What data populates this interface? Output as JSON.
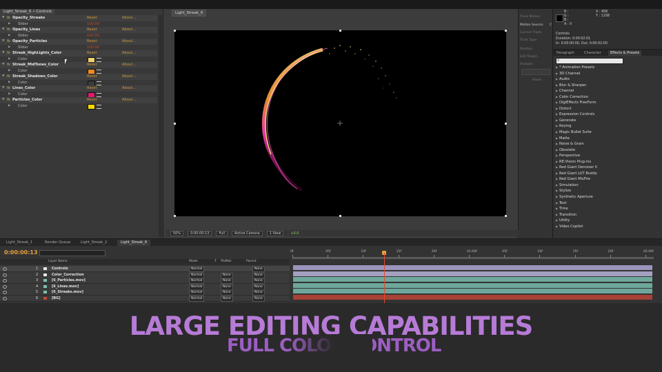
{
  "effect_controls": {
    "tab": "Light_Streak_6 • Controls",
    "reset_label": "Reset",
    "about_label": "About...",
    "rows": [
      {
        "kind": "effect",
        "name": "Opacity_Streaks"
      },
      {
        "kind": "sub",
        "name": "Slider",
        "value": "100.00"
      },
      {
        "kind": "effect",
        "name": "Opacity_Lines"
      },
      {
        "kind": "sub",
        "name": "Slider",
        "value": "100.00"
      },
      {
        "kind": "effect",
        "name": "Opacity_Particles"
      },
      {
        "kind": "sub",
        "name": "Slider",
        "value": "100.00"
      },
      {
        "kind": "effect",
        "name": "Streak_HighLights_Color"
      },
      {
        "kind": "color",
        "name": "Color",
        "color": "#f1d06e"
      },
      {
        "kind": "effect",
        "name": "Streak_MidTones_Color"
      },
      {
        "kind": "color",
        "name": "Color",
        "color": "#f08a1c"
      },
      {
        "kind": "effect",
        "name": "Streak_Shadows_Color"
      },
      {
        "kind": "color",
        "name": "Color",
        "color": "#3a3a3a"
      },
      {
        "kind": "effect",
        "name": "Lines_Color"
      },
      {
        "kind": "color",
        "name": "Color",
        "color": "#e0196e"
      },
      {
        "kind": "effect",
        "name": "Particles_Color"
      },
      {
        "kind": "color",
        "name": "Color",
        "color": "#f5d800"
      }
    ]
  },
  "viewer": {
    "tab": "Light_Streak_6",
    "toolbar": [
      "50%",
      "0:00:00:13",
      "Full",
      "Active Camera",
      "1 View",
      "+0.0"
    ]
  },
  "tracker_panel": {
    "items": [
      "Track Motion",
      "Motion Source:",
      "Current Track:",
      "Track Type:",
      "Position",
      "Edit Target...",
      "Analyze:",
      "Reset"
    ],
    "motion_source_value": "C"
  },
  "info": {
    "rgba": [
      "R :",
      "G :",
      "B :",
      "A : 0"
    ],
    "xy": [
      "X : 458",
      "Y : 1108"
    ],
    "layer": "Controls",
    "duration": "Duration: 0:00:02:01",
    "in_out": "In: 0:00:00:00, Out: 0:00:02:00"
  },
  "effects_presets": {
    "tabs": [
      "Paragraph",
      "Character",
      "Effects & Presets"
    ],
    "items": [
      "* Animation Presets",
      "3D Channel",
      "Audio",
      "Blur & Sharpen",
      "Channel",
      "Color Correction",
      "DigiEffects FreeForm",
      "Distort",
      "Expression Controls",
      "Generate",
      "Keying",
      "Magic Bullet Suite",
      "Matte",
      "Noise & Grain",
      "Obsolete",
      "Perspective",
      "RE:Vision Plug-ins",
      "Red Giant Denoiser II",
      "Red Giant LUT Buddy",
      "Red Giant MisFire",
      "Simulation",
      "Stylize",
      "Synthetic Aperture",
      "Text",
      "Time",
      "Transition",
      "Utility",
      "Video Copilot"
    ]
  },
  "timeline": {
    "tabs": [
      "Light_Streak_1",
      "Render Queue",
      "Light_Streak_2",
      "Light_Streak_6"
    ],
    "timecode": "0:00:00:13",
    "headers": [
      "Layer Name",
      "Mode",
      "T",
      "TrkMat",
      "Parent"
    ],
    "ruler": [
      "0f",
      "05f",
      "10f",
      "15f",
      "20f",
      "01:00f",
      "05f",
      "10f",
      "15f",
      "20f",
      "02:00f"
    ],
    "layers": [
      {
        "num": "1",
        "name": "Controls",
        "label": "#e8e8e8",
        "bar": "#9b95bd",
        "mode": "Normal",
        "trkmat": "",
        "parent": "None"
      },
      {
        "num": "2",
        "name": "Color_Correction",
        "label": "#e8e8e8",
        "bar": "#a4a0bf",
        "mode": "Normal",
        "trkmat": "None",
        "parent": "None"
      },
      {
        "num": "3",
        "name": "[6_Particles.mov]",
        "label": "#7fbfb0",
        "bar": "#6ea79b",
        "mode": "Normal",
        "trkmat": "None",
        "parent": "None"
      },
      {
        "num": "4",
        "name": "[6_Lines.mov]",
        "label": "#7fbfb0",
        "bar": "#6ea79b",
        "mode": "Normal",
        "trkmat": "None",
        "parent": "None"
      },
      {
        "num": "5",
        "name": "[6_Streaks.mov]",
        "label": "#7fbfb0",
        "bar": "#6ea79b",
        "mode": "Normal",
        "trkmat": "None",
        "parent": "None"
      },
      {
        "num": "6",
        "name": "[BG]",
        "label": "#c24a3a",
        "bar": "#a84236",
        "mode": "Normal",
        "trkmat": "None",
        "parent": "None"
      }
    ]
  },
  "overlay": {
    "headline": "LARGE EDITING CAPABILITIES",
    "subline": "FULL COLOR CONTROL"
  }
}
